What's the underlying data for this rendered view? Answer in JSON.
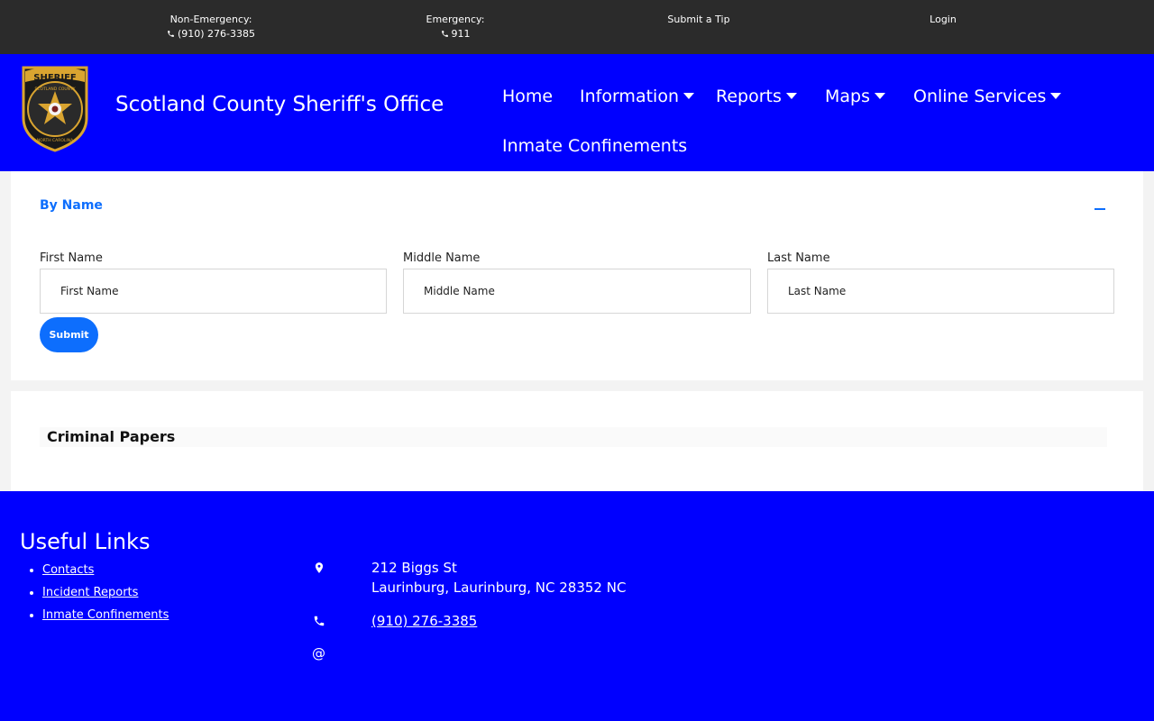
{
  "topbar": {
    "non_emergency_label": "Non-Emergency:",
    "non_emergency_phone": "(910) 276-3385",
    "emergency_label": "Emergency:",
    "emergency_phone": "911",
    "submit_tip": "Submit a Tip",
    "login": "Login"
  },
  "header": {
    "title": "Scotland County Sheriff's Office",
    "logo": {
      "badge_text": "SHERIFF",
      "ring_top": "SCOTLAND COUNTY",
      "ring_bottom": "NORTH CAROLINA"
    },
    "nav": [
      {
        "label": "Home"
      },
      {
        "label": "Information"
      },
      {
        "label": "Reports"
      },
      {
        "label": "Maps"
      },
      {
        "label": "Online Services"
      },
      {
        "label": "Inmate Confinements"
      }
    ]
  },
  "search": {
    "section_title": "By Name",
    "collapse_icon": "minus-icon",
    "fields": [
      {
        "label": "First Name",
        "placeholder": "First Name",
        "value": ""
      },
      {
        "label": "Middle Name",
        "placeholder": "Middle Name",
        "value": ""
      },
      {
        "label": "Last Name",
        "placeholder": "Last Name",
        "value": ""
      }
    ],
    "submit_label": "Submit"
  },
  "papers": {
    "title": "Criminal Papers"
  },
  "footer": {
    "useful_links_title": "Useful Links",
    "links": [
      {
        "label": "Contacts"
      },
      {
        "label": "Incident Reports"
      },
      {
        "label": "Inmate Confinements"
      }
    ],
    "address_line1": "212 Biggs St",
    "address_line2": "Laurinburg, Laurinburg, NC 28352 NC",
    "phone": "(910) 276-3385",
    "email_icon": "@"
  },
  "colors": {
    "topbar_bg": "#2b2b2b",
    "brand_blue": "#0000ff",
    "accent_blue": "#0d6efd",
    "badge_gold": "#d9a430"
  }
}
